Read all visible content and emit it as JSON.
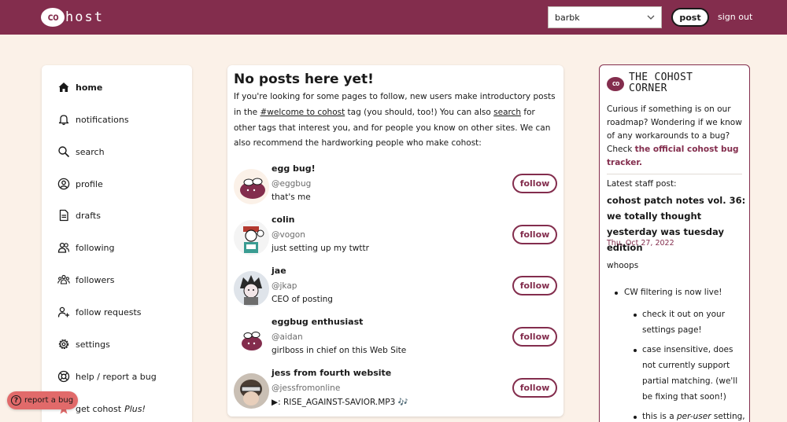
{
  "header": {
    "logo_text": "host",
    "logo_badge": "co",
    "page_selector_value": "barbk",
    "post_label": "post",
    "signout_label": "sign out"
  },
  "sidebar": {
    "items": [
      {
        "label": "home",
        "icon": "home-icon"
      },
      {
        "label": "notifications",
        "icon": "bell-icon"
      },
      {
        "label": "search",
        "icon": "search-icon"
      },
      {
        "label": "profile",
        "icon": "user-circle-icon"
      },
      {
        "label": "drafts",
        "icon": "document-icon"
      },
      {
        "label": "following",
        "icon": "users-icon"
      },
      {
        "label": "followers",
        "icon": "user-group-icon"
      },
      {
        "label": "follow requests",
        "icon": "user-add-icon"
      },
      {
        "label": "settings",
        "icon": "gear-icon"
      },
      {
        "label": "help / report a bug",
        "icon": "lifebuoy-icon"
      },
      {
        "label": "get cohost",
        "icon": "star-icon",
        "suffix": "Plus!"
      }
    ]
  },
  "main": {
    "title": "No posts here yet!",
    "intro_1": "If you're looking for some pages to follow, new users make introductory posts in the ",
    "intro_tag": "#welcome to cohost",
    "intro_2": " tag (you should, too!) You can also ",
    "intro_search": "search",
    "intro_3": " for other tags that interest you, and for people you know on other sites. We can also recommend the hardworking people who make cohost:",
    "follow_label": "follow",
    "users": [
      {
        "name": "egg bug!",
        "handle": "@eggbug",
        "bio": "that's me"
      },
      {
        "name": "colin",
        "handle": "@vogon",
        "bio": "just setting up my twttr"
      },
      {
        "name": "jae",
        "handle": "@jkap",
        "bio": "CEO of posting"
      },
      {
        "name": "eggbug enthusiast",
        "handle": "@aidan",
        "bio": "girlboss in chief on this Web Site"
      },
      {
        "name": "jess from fourth website",
        "handle": "@jessfromonline",
        "bio": "▶: RISE_AGAINST-SAVIOR.MP3 🎶"
      }
    ]
  },
  "corner": {
    "title": "THE COHOST CORNER",
    "text": "Curious if something is on our roadmap? Wondering if we know of any workarounds to a bug? Check ",
    "link": "the official cohost bug tracker.",
    "staff_label": "Latest staff post:",
    "staff_title": "cohost patch notes vol. 36: we totally thought yesterday was tuesday edition",
    "staff_date": "Thu, Oct 27, 2022",
    "body_intro": "whoops",
    "bullet_1": "CW filtering is now live!",
    "sub_1": "check it out on your settings page!",
    "sub_2": "case insensitive, does not currently support partial matching. (we'll be fixing that soon!)",
    "sub_3_a": "this is a ",
    "sub_3_em": "per-user",
    "sub_3_b": " setting,"
  },
  "report_bug_label": "report a bug",
  "colors": {
    "brand": "#832d4d",
    "background": "#fbf1e8",
    "report_bug": "#e16a6a"
  }
}
